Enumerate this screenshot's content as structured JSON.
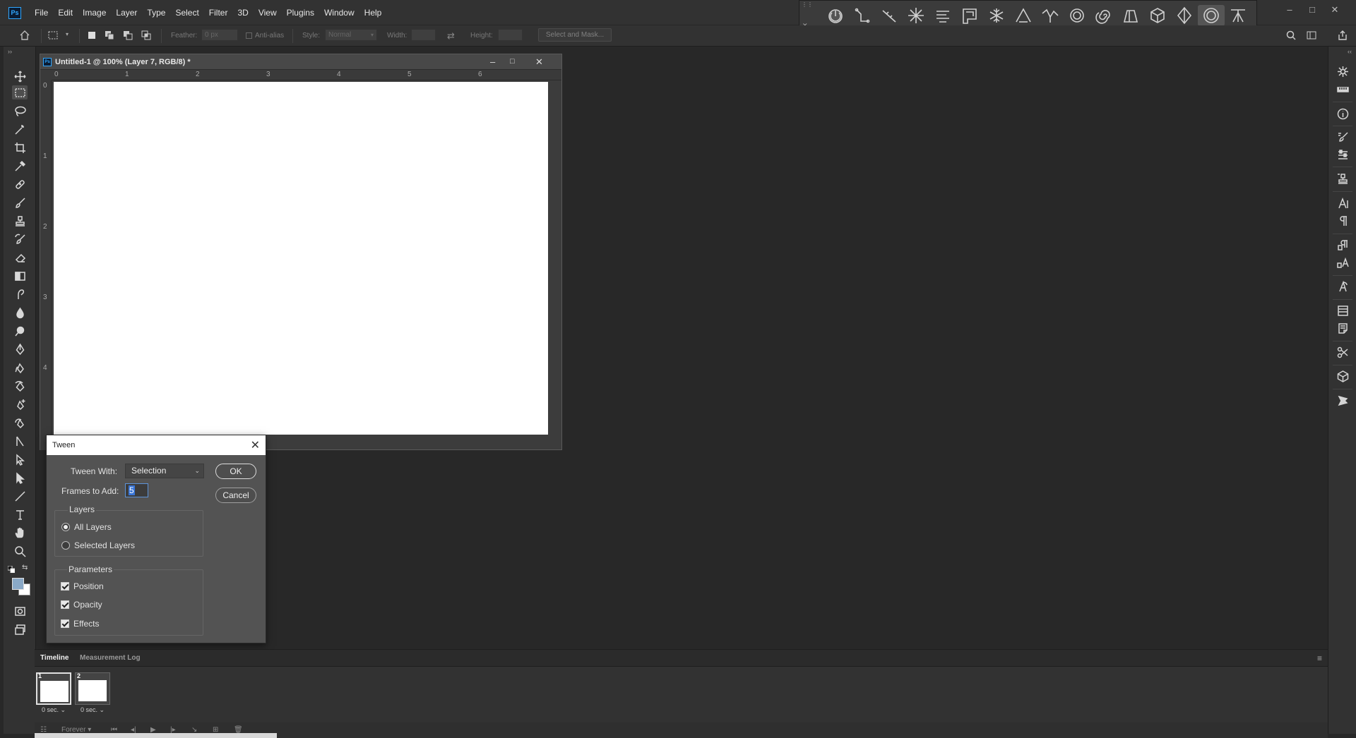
{
  "app": {
    "logo_text": "Ps",
    "menu": [
      "File",
      "Edit",
      "Image",
      "Layer",
      "Type",
      "Select",
      "Filter",
      "3D",
      "View",
      "Plugins",
      "Window",
      "Help"
    ],
    "window_controls": [
      "–",
      "□",
      "✕"
    ]
  },
  "plugin_toolbar": {
    "icons": [
      "power-icon",
      "connect-icon",
      "line-icon",
      "star-burst-icon",
      "align-icon",
      "frame-icon",
      "snowflake-icon",
      "angle-icon",
      "wave-icon",
      "ring-icon",
      "spiral-icon",
      "shape-icon",
      "cube-icon",
      "diamond-icon",
      "circle-target-icon",
      "arch-icon"
    ],
    "active_index": 14
  },
  "options_bar": {
    "feather_label": "Feather:",
    "feather_value": "0 px",
    "antialias_label": "Anti-alias",
    "style_label": "Style:",
    "style_value": "Normal",
    "width_label": "Width:",
    "height_label": "Height:",
    "select_mask_label": "Select and Mask..."
  },
  "document": {
    "title": "Untitled-1 @ 100% (Layer 7, RGB/8) *",
    "ruler_h": [
      "0",
      "1",
      "2",
      "3",
      "4",
      "5",
      "6"
    ],
    "ruler_v": [
      "0",
      "1",
      "2",
      "3",
      "4"
    ]
  },
  "tween_dialog": {
    "title": "Tween",
    "tween_with_label": "Tween With:",
    "tween_with_value": "Selection",
    "frames_label": "Frames to Add:",
    "frames_value": "5",
    "ok_label": "OK",
    "cancel_label": "Cancel",
    "layers_group": "Layers",
    "all_layers": "All Layers",
    "selected_layers": "Selected Layers",
    "params_group": "Parameters",
    "position": "Position",
    "opacity": "Opacity",
    "effects": "Effects"
  },
  "timeline": {
    "tabs": [
      "Timeline",
      "Measurement Log"
    ],
    "frames": [
      {
        "num": "1",
        "duration": "0 sec."
      },
      {
        "num": "2",
        "duration": "0 sec."
      }
    ],
    "loop_label": "Forever"
  }
}
